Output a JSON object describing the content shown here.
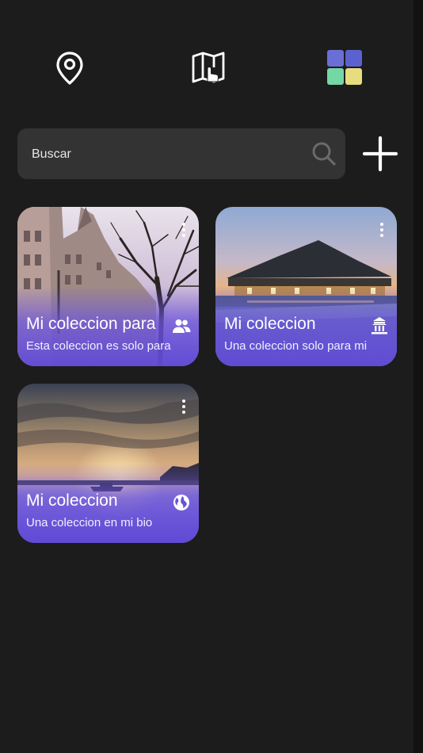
{
  "nav": {
    "items": [
      {
        "icon": "location-pin-icon"
      },
      {
        "icon": "map-touch-icon"
      },
      {
        "icon": "collections-grid-icon"
      }
    ],
    "grid_colors": [
      "#6a6fd6",
      "#5b62d0",
      "#74d8a6",
      "#e6dd7e"
    ]
  },
  "search": {
    "placeholder": "Buscar",
    "value": ""
  },
  "actions": {
    "add_icon": "plus-icon"
  },
  "collections": [
    {
      "title": "Mi coleccion para",
      "description": "Esta coleccion es solo para",
      "privacy_icon": "people-icon"
    },
    {
      "title": "Mi coleccion",
      "description": "Una coleccion solo para mi",
      "privacy_icon": "temple-icon"
    },
    {
      "title": "Mi coleccion",
      "description": "Una coleccion en mi bio",
      "privacy_icon": "globe-icon"
    }
  ],
  "colors": {
    "background": "#1c1c1c",
    "search_bg": "#333333",
    "card_overlay": "#6a52dc"
  }
}
